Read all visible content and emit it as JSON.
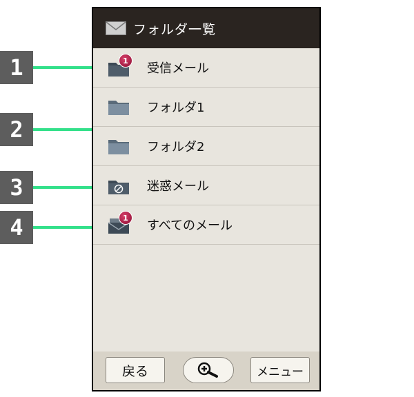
{
  "header": {
    "title": "フォルダ一覧",
    "icon": "mail-icon"
  },
  "folders": [
    {
      "label": "受信メール",
      "icon": "inbox-folder-icon",
      "badge": "1"
    },
    {
      "label": "フォルダ1",
      "icon": "folder-icon"
    },
    {
      "label": "フォルダ2",
      "icon": "folder-icon"
    },
    {
      "label": "迷惑メール",
      "icon": "spam-folder-icon"
    },
    {
      "label": "すべてのメール",
      "icon": "all-mail-icon",
      "badge": "1"
    }
  ],
  "bottom": {
    "back_label": "戻る",
    "zoom_icon": "zoom-in-icon",
    "menu_label": "メニュー"
  },
  "callouts": [
    "1",
    "2",
    "3",
    "4"
  ],
  "colors": {
    "callout_line": "#33e08a",
    "callout_box": "#5d5d5d",
    "header_bg": "#2a2420",
    "list_bg": "#e8e5de",
    "badge": "#b01a48"
  }
}
